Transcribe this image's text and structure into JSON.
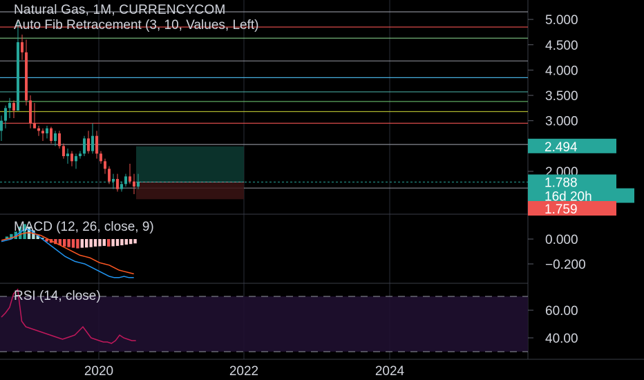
{
  "title": "Natural Gas, 1M, CURRENCYCOM",
  "fib_label": "Auto Fib Retracement (3, 10, Values, Left)",
  "macd_label": "MACD (12, 26, close, 9)",
  "rsi_label": "RSI (14, close)",
  "colors": {
    "background": "#000000",
    "up": "#26a69a",
    "down": "#ef5350",
    "grid": "#2a2e39",
    "text": "#d1d4dc",
    "macd_line": "#2962ff",
    "signal_line": "#ff6d00",
    "rsi_line": "#7e57c2",
    "rsi_band": "#1f1030",
    "target_zone": "#0d3b33",
    "stop_zone": "#3b1414"
  },
  "chart_data": [
    {
      "type": "candlestick",
      "title": "Natural Gas, 1M, CURRENCYCOM",
      "price_axis": {
        "ticks": [
          "5.000",
          "4.500",
          "4.000",
          "3.500",
          "3.000",
          "2.000"
        ],
        "range": [
          1.45,
          5.3
        ]
      },
      "time_axis": {
        "ticks": [
          "2020",
          "2022",
          "2024"
        ]
      },
      "fib_levels": [
        {
          "value": 5.15,
          "color": "#9598a1"
        },
        {
          "value": 4.85,
          "color": "#ef5350"
        },
        {
          "value": 4.63,
          "color": "#81c784"
        },
        {
          "value": 4.18,
          "color": "#9598a1"
        },
        {
          "value": 3.85,
          "color": "#4fc3f7"
        },
        {
          "value": 3.57,
          "color": "#4db6ac"
        },
        {
          "value": 3.38,
          "color": "#66bb6a"
        },
        {
          "value": 3.18,
          "color": "#c0ca33"
        },
        {
          "value": 2.95,
          "color": "#ef5350"
        },
        {
          "value": 2.53,
          "color": "#9598a1"
        },
        {
          "value": 1.67,
          "color": "#9598a1"
        }
      ],
      "candles": [
        {
          "o": 2.8,
          "h": 3.1,
          "l": 2.6,
          "c": 3.0
        },
        {
          "o": 3.0,
          "h": 3.3,
          "l": 2.85,
          "c": 3.25
        },
        {
          "o": 3.25,
          "h": 3.45,
          "l": 3.05,
          "c": 3.35
        },
        {
          "o": 3.35,
          "h": 3.4,
          "l": 3.05,
          "c": 3.2
        },
        {
          "o": 3.2,
          "h": 4.95,
          "l": 3.2,
          "c": 4.55
        },
        {
          "o": 4.55,
          "h": 4.7,
          "l": 4.2,
          "c": 4.35
        },
        {
          "o": 4.35,
          "h": 4.6,
          "l": 3.3,
          "c": 3.4
        },
        {
          "o": 3.4,
          "h": 3.5,
          "l": 2.85,
          "c": 2.95
        },
        {
          "o": 2.95,
          "h": 3.35,
          "l": 2.85,
          "c": 2.85
        },
        {
          "o": 2.85,
          "h": 2.9,
          "l": 2.7,
          "c": 2.8
        },
        {
          "o": 2.8,
          "h": 2.85,
          "l": 2.6,
          "c": 2.75
        },
        {
          "o": 2.75,
          "h": 2.9,
          "l": 2.65,
          "c": 2.85
        },
        {
          "o": 2.85,
          "h": 2.88,
          "l": 2.55,
          "c": 2.6
        },
        {
          "o": 2.6,
          "h": 2.8,
          "l": 2.5,
          "c": 2.75
        },
        {
          "o": 2.75,
          "h": 2.8,
          "l": 2.45,
          "c": 2.5
        },
        {
          "o": 2.5,
          "h": 2.55,
          "l": 2.25,
          "c": 2.3
        },
        {
          "o": 2.3,
          "h": 2.45,
          "l": 2.15,
          "c": 2.35
        },
        {
          "o": 2.35,
          "h": 2.4,
          "l": 2.1,
          "c": 2.2
        },
        {
          "o": 2.2,
          "h": 2.35,
          "l": 2.05,
          "c": 2.3
        },
        {
          "o": 2.3,
          "h": 2.4,
          "l": 2.25,
          "c": 2.35
        },
        {
          "o": 2.35,
          "h": 2.7,
          "l": 2.3,
          "c": 2.65
        },
        {
          "o": 2.65,
          "h": 2.8,
          "l": 2.35,
          "c": 2.4
        },
        {
          "o": 2.4,
          "h": 2.95,
          "l": 2.35,
          "c": 2.7
        },
        {
          "o": 2.7,
          "h": 2.8,
          "l": 2.25,
          "c": 2.35
        },
        {
          "o": 2.35,
          "h": 2.4,
          "l": 2.15,
          "c": 2.2
        },
        {
          "o": 2.2,
          "h": 2.25,
          "l": 1.95,
          "c": 2.05
        },
        {
          "o": 2.05,
          "h": 2.1,
          "l": 1.75,
          "c": 1.8
        },
        {
          "o": 1.8,
          "h": 1.95,
          "l": 1.65,
          "c": 1.85
        },
        {
          "o": 1.85,
          "h": 1.95,
          "l": 1.6,
          "c": 1.65
        },
        {
          "o": 1.65,
          "h": 1.8,
          "l": 1.6,
          "c": 1.75
        },
        {
          "o": 1.75,
          "h": 1.95,
          "l": 1.7,
          "c": 1.9
        },
        {
          "o": 1.9,
          "h": 2.15,
          "l": 1.75,
          "c": 1.8
        },
        {
          "o": 1.8,
          "h": 1.95,
          "l": 1.55,
          "c": 1.7
        },
        {
          "o": 1.7,
          "h": 1.95,
          "l": 1.65,
          "c": 1.79
        }
      ],
      "position": {
        "target": 2.494,
        "entry": 1.788,
        "stop": 1.45
      },
      "price_badges": [
        {
          "text": "2.494",
          "value": 2.494,
          "color": "#26a69a"
        },
        {
          "text": "1.788",
          "value": 1.788,
          "color": "#26a69a"
        },
        {
          "text": "16d 20h",
          "value": 1.655,
          "color": "#26a69a"
        },
        {
          "text": "1.759",
          "value": 1.45,
          "color": "#ef5350"
        }
      ]
    },
    {
      "type": "histogram+line",
      "title": "MACD (12, 26, close, 9)",
      "axis_ticks": [
        "0.000",
        "−0.200"
      ],
      "histogram": [
        0.02,
        0.04,
        0.06,
        0.1,
        0.12,
        0.1,
        0.07,
        0.03,
        0.01,
        -0.02,
        -0.03,
        -0.04,
        -0.05,
        -0.06,
        -0.065,
        -0.07,
        -0.075,
        -0.07,
        -0.068,
        -0.065,
        -0.06,
        -0.058,
        -0.055,
        -0.06,
        -0.058,
        -0.055,
        -0.05,
        -0.045,
        -0.04,
        -0.035
      ],
      "macd_line": [
        -0.02,
        -0.01,
        0.0,
        0.03,
        0.06,
        0.08,
        0.07,
        0.04,
        0.01,
        -0.02,
        -0.05,
        -0.08,
        -0.11,
        -0.14,
        -0.16,
        -0.18,
        -0.19,
        -0.2,
        -0.22,
        -0.24,
        -0.26,
        -0.28,
        -0.3,
        -0.31,
        -0.31,
        -0.3,
        -0.31,
        -0.31
      ],
      "signal_line": [
        -0.01,
        0.0,
        0.01,
        0.02,
        0.04,
        0.05,
        0.05,
        0.04,
        0.03,
        0.01,
        -0.01,
        -0.03,
        -0.05,
        -0.07,
        -0.09,
        -0.11,
        -0.13,
        -0.14,
        -0.15,
        -0.17,
        -0.19,
        -0.2,
        -0.21,
        -0.23,
        -0.25,
        -0.26,
        -0.27,
        -0.28
      ]
    },
    {
      "type": "line",
      "title": "RSI (14, close)",
      "axis_ticks": [
        "60.00",
        "40.00"
      ],
      "bands": [
        70,
        30
      ],
      "rsi": [
        55,
        58,
        62,
        72,
        75,
        52,
        48,
        47,
        46,
        45,
        44,
        43,
        42,
        41,
        40,
        39,
        40,
        41,
        42,
        45,
        48,
        44,
        40,
        39,
        38,
        37,
        37,
        36,
        38,
        42,
        40,
        39,
        38,
        38
      ]
    }
  ]
}
